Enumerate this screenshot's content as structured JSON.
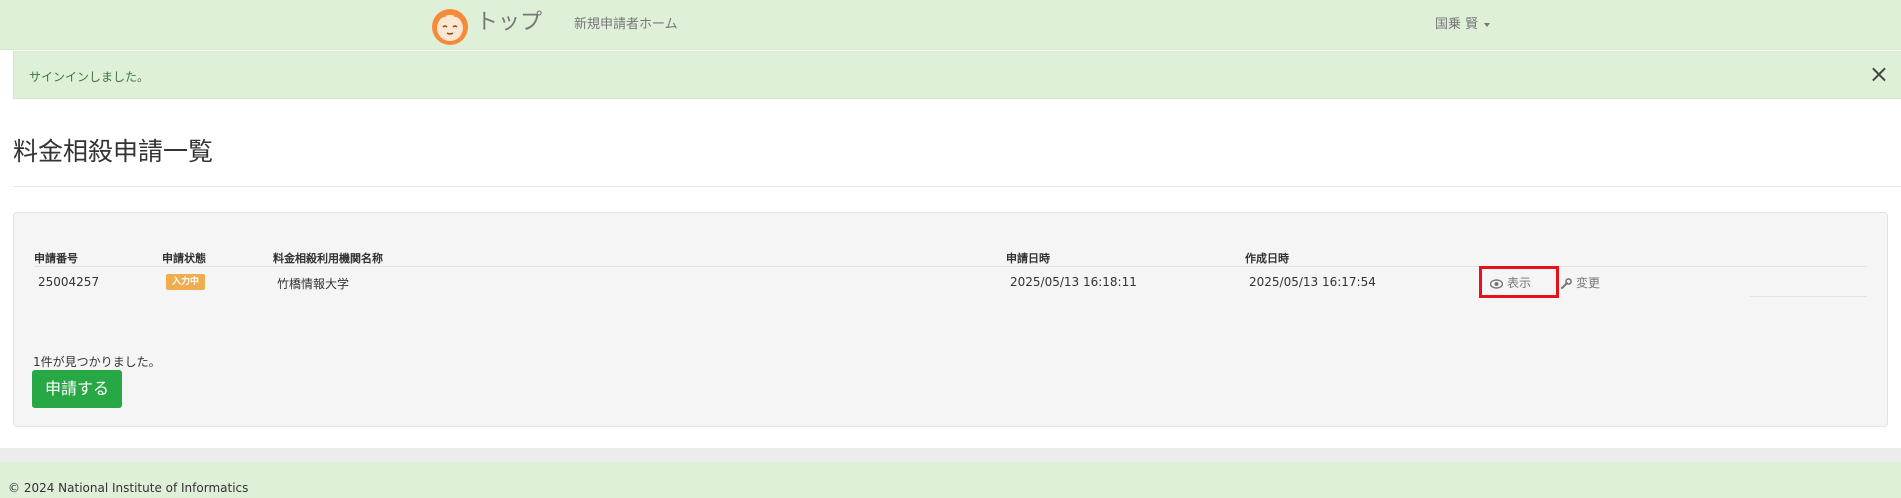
{
  "navbar": {
    "brand": "トップ",
    "brand_logo": "cat-mascot-logo",
    "new_applicant_home": "新規申請者ホーム",
    "user_name": "国乗 賢"
  },
  "alert": {
    "message": "サインインしました。",
    "close_icon": "×"
  },
  "page": {
    "title": "料金相殺申請一覧"
  },
  "table": {
    "headers": [
      "申請番号",
      "申請状態",
      "料金相殺利用機関名称",
      "申請日時",
      "作成日時"
    ],
    "rows": [
      {
        "application_number": "25004257",
        "status": "入力中",
        "institution": "竹橋情報大学",
        "applied_at": "2025/05/13 16:18:11",
        "created_at": "2025/05/13 16:17:54",
        "view_label": "表示",
        "edit_label": "変更"
      }
    ]
  },
  "result_count": "1件が見つかりました。",
  "apply_button": "申請する",
  "footer": {
    "copyright": "© 2024 National Institute of Informatics"
  },
  "colors": {
    "navbar_bg": "#dff0d8",
    "alert_text": "#3c763d",
    "status_badge": "#f0ad4e",
    "apply_button": "#28a745",
    "highlight_box": "#e8101a"
  }
}
